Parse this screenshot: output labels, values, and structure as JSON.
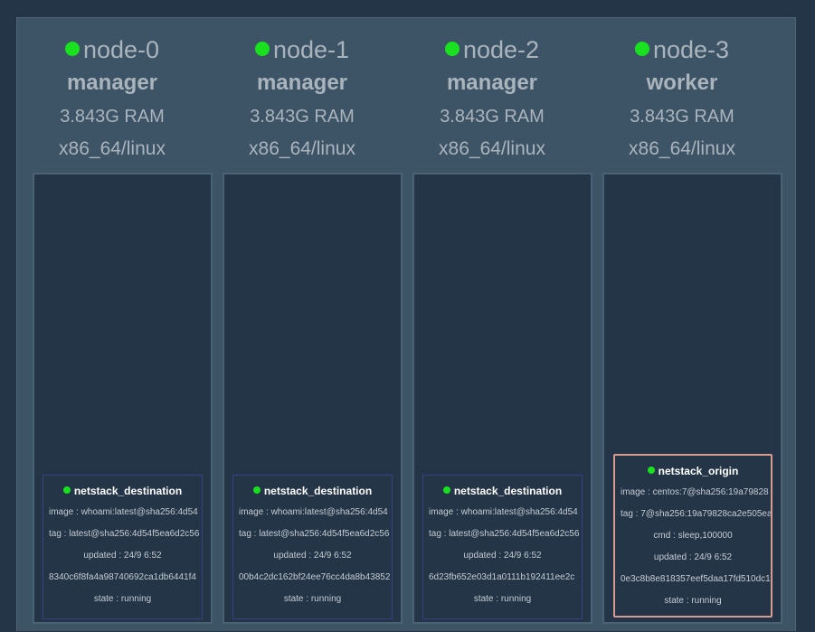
{
  "nodes": [
    {
      "name": "node-0",
      "role": "manager",
      "ram": "3.843G RAM",
      "arch": "x86_64/linux",
      "task": {
        "kind": "dest",
        "name": "netstack_destination",
        "image": "image : whoami:latest@sha256:4d54",
        "tag": "tag : latest@sha256:4d54f5ea6d2c56",
        "cmd": "",
        "updated": "updated : 24/9 6:52",
        "id": "8340c6f8fa4a98740692ca1db6441f4",
        "state": "state : running"
      }
    },
    {
      "name": "node-1",
      "role": "manager",
      "ram": "3.843G RAM",
      "arch": "x86_64/linux",
      "task": {
        "kind": "dest",
        "name": "netstack_destination",
        "image": "image : whoami:latest@sha256:4d54",
        "tag": "tag : latest@sha256:4d54f5ea6d2c56",
        "cmd": "",
        "updated": "updated : 24/9 6:52",
        "id": "00b4c2dc162bf24ee76cc4da8b43852",
        "state": "state : running"
      }
    },
    {
      "name": "node-2",
      "role": "manager",
      "ram": "3.843G RAM",
      "arch": "x86_64/linux",
      "task": {
        "kind": "dest",
        "name": "netstack_destination",
        "image": "image : whoami:latest@sha256:4d54",
        "tag": "tag : latest@sha256:4d54f5ea6d2c56",
        "cmd": "",
        "updated": "updated : 24/9 6:52",
        "id": "6d23fb652e03d1a0111b192411ee2c",
        "state": "state : running"
      }
    },
    {
      "name": "node-3",
      "role": "worker",
      "ram": "3.843G RAM",
      "arch": "x86_64/linux",
      "task": {
        "kind": "origin",
        "name": "netstack_origin",
        "image": "image : centos:7@sha256:19a79828",
        "tag": "tag : 7@sha256:19a79828ca2e505ea",
        "cmd": "cmd : sleep,100000",
        "updated": "updated : 24/9 6:52",
        "id": "0e3c8b8e818357eef5daa17fd510dc1",
        "state": "state : running"
      }
    }
  ],
  "colors": {
    "status_ok": "#19e11f",
    "origin_border": "#d79a8e",
    "dest_border": "#3a3f86"
  },
  "icons": {
    "node_status": "green-status-dot",
    "task_status": "green-status-dot"
  }
}
